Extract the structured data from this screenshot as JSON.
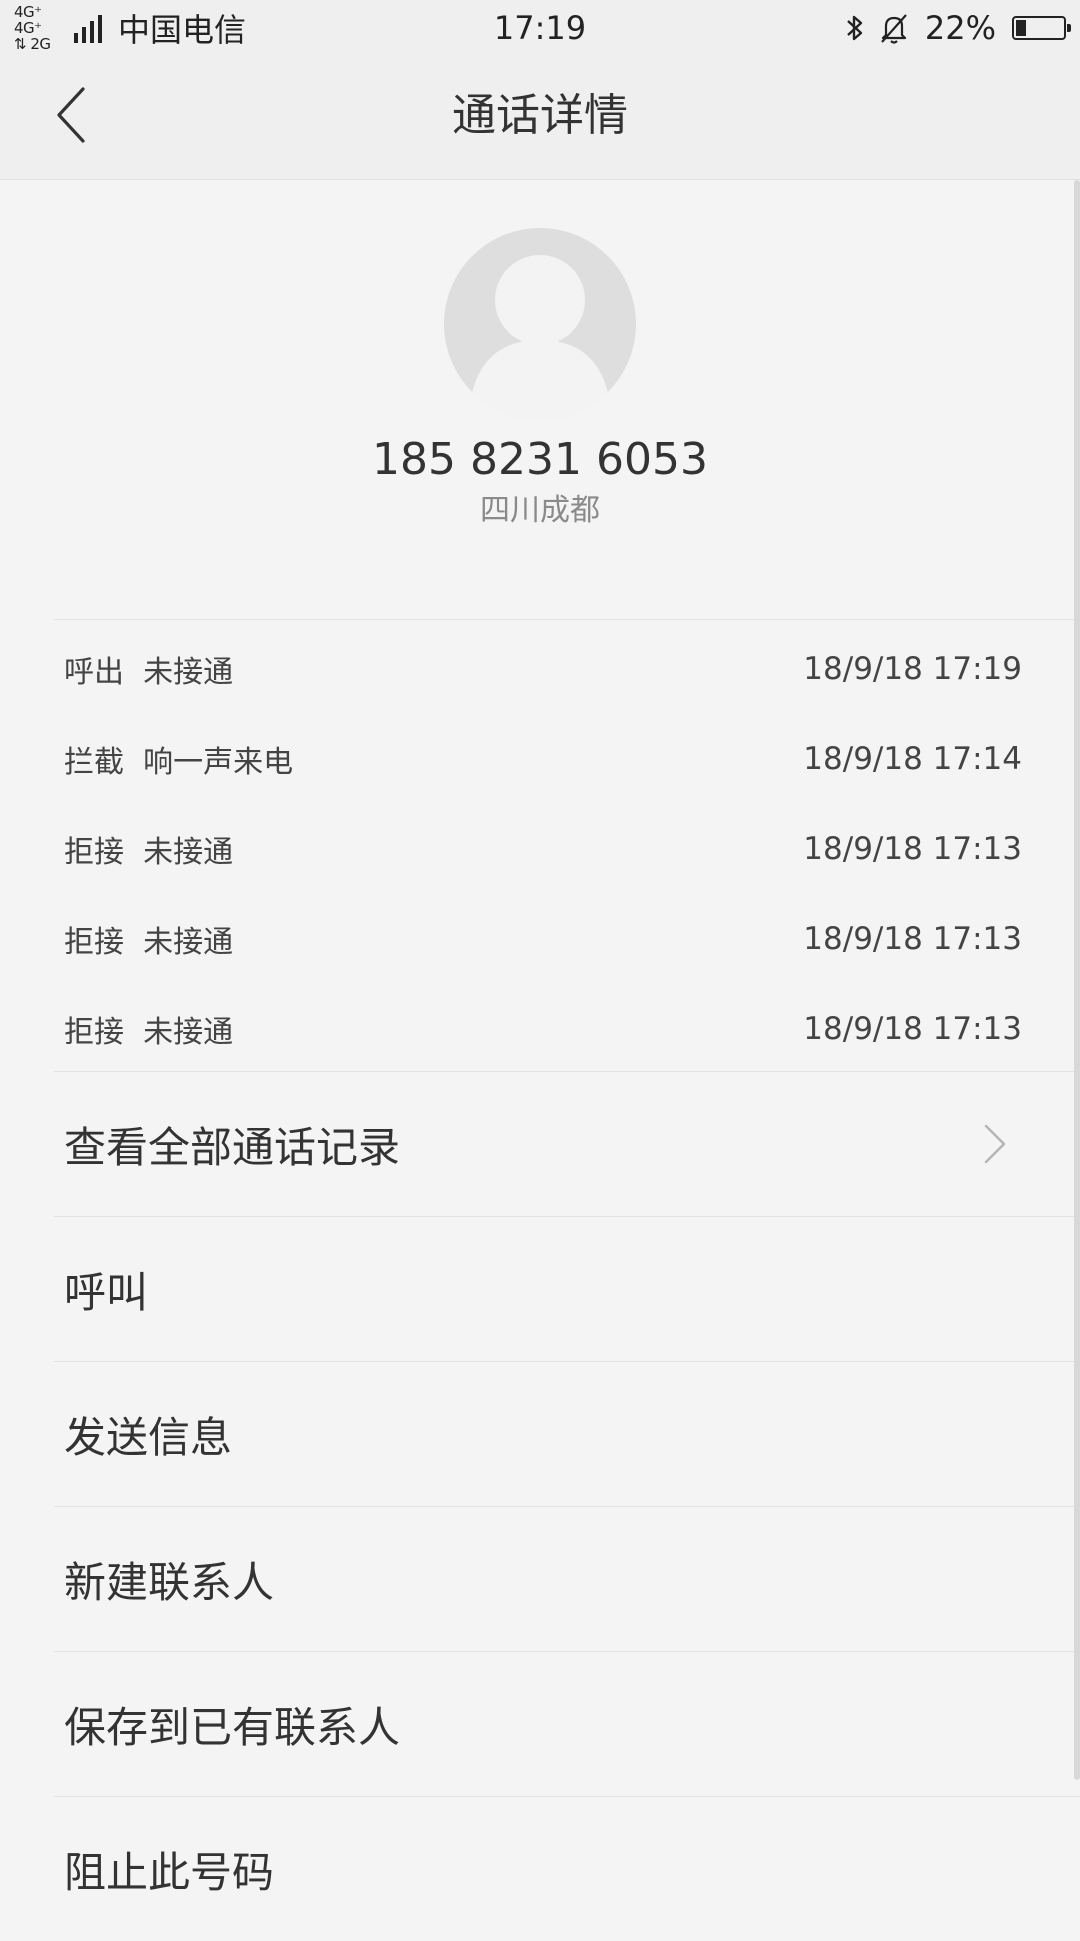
{
  "status_bar": {
    "network_top": "4G⁺ 4G⁺",
    "network_bottom": "⇅ 2G",
    "carrier": "中国电信",
    "time": "17:19",
    "battery_percent": "22%",
    "battery_level": 0.22
  },
  "header": {
    "title": "通话详情"
  },
  "contact": {
    "phone_number": "185 8231 6053",
    "location": "四川成都"
  },
  "call_log": [
    {
      "type": "呼出  未接通",
      "time": "18/9/18 17:19"
    },
    {
      "type": "拦截  响一声来电",
      "time": "18/9/18 17:14"
    },
    {
      "type": "拒接  未接通",
      "time": "18/9/18 17:13"
    },
    {
      "type": "拒接  未接通",
      "time": "18/9/18 17:13"
    },
    {
      "type": "拒接  未接通",
      "time": "18/9/18 17:13"
    }
  ],
  "actions": {
    "view_all": "查看全部通话记录",
    "call": "呼叫",
    "send_message": "发送信息",
    "new_contact": "新建联系人",
    "save_existing": "保存到已有联系人",
    "block": "阻止此号码"
  },
  "colors": {
    "background": "#f4f4f4",
    "header_background": "#efefef",
    "avatar": "#dedede",
    "text": "#333333",
    "secondary_text": "#8a8a8a"
  }
}
